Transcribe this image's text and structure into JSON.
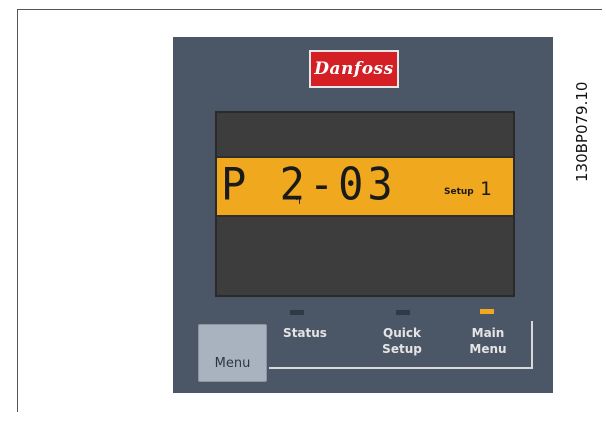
{
  "brand": {
    "logo_text": "Danfoss"
  },
  "display": {
    "parameter": "P 2-03",
    "setup_label": "Setup",
    "setup_number": "1",
    "back_symbol": "↰"
  },
  "indicators": [
    {
      "label": "Status",
      "led_on": false
    },
    {
      "label_line1": "Quick",
      "label_line2": "Setup",
      "led_on": false
    },
    {
      "label_line1": "Main",
      "label_line2": "Menu",
      "led_on": true
    }
  ],
  "menu_button": {
    "label": "Menu"
  },
  "figure_code": "130BP079.10",
  "colors": {
    "panel": "#4b5766",
    "lcd_highlight": "#f0a81f",
    "logo_red": "#d42024",
    "led_on": "#f0a81f"
  }
}
